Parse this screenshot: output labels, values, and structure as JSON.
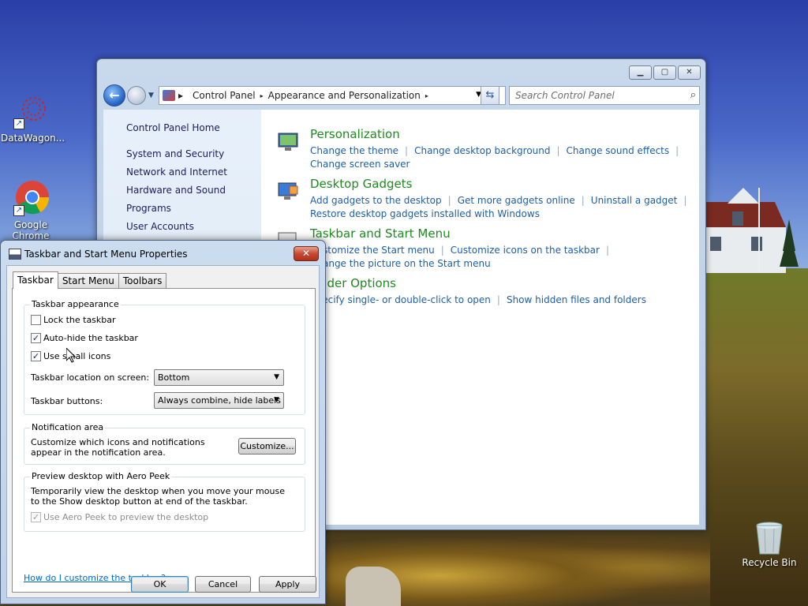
{
  "desktop": {
    "icons": [
      {
        "label": "DataWagon...",
        "icon": "datawagon-icon"
      },
      {
        "label": "Google Chrome",
        "icon": "chrome-icon"
      },
      {
        "label": "Recycle Bin",
        "icon": "recycle-bin-icon"
      }
    ]
  },
  "control_panel": {
    "caption": {
      "minimize": "minimize-icon",
      "maximize": "maximize-icon",
      "close": "close-icon"
    },
    "breadcrumb": [
      "Control Panel",
      "Appearance and Personalization"
    ],
    "search_placeholder": "Search Control Panel",
    "sidebar": {
      "home": "Control Panel Home",
      "items": [
        "System and Security",
        "Network and Internet",
        "Hardware and Sound",
        "Programs",
        "User Accounts"
      ]
    },
    "categories": [
      {
        "title": "Personalization",
        "icon": "personalization-icon",
        "links": [
          "Change the theme",
          "Change desktop background",
          "Change sound effects",
          "Change screen saver"
        ]
      },
      {
        "title": "Desktop Gadgets",
        "icon": "gadgets-icon",
        "links": [
          "Add gadgets to the desktop",
          "Get more gadgets online",
          "Uninstall a gadget",
          "Restore desktop gadgets installed with Windows"
        ]
      },
      {
        "title": "Taskbar and Start Menu",
        "icon": "taskbar-icon",
        "links": [
          "Customize the Start menu",
          "Customize icons on the taskbar",
          "Change the picture on the Start menu"
        ]
      },
      {
        "title": "Folder Options",
        "icon": "folder-options-icon",
        "links": [
          "Specify single- or double-click to open",
          "Show hidden files and folders"
        ]
      }
    ]
  },
  "dialog": {
    "title": "Taskbar and Start Menu Properties",
    "close_label": "✕",
    "tabs": [
      "Taskbar",
      "Start Menu",
      "Toolbars"
    ],
    "active_tab": "Taskbar",
    "appearance": {
      "group_label": "Taskbar appearance",
      "lock": {
        "label": "Lock the taskbar",
        "checked": false
      },
      "autohide": {
        "label": "Auto-hide the taskbar",
        "checked": true
      },
      "small_icons": {
        "label": "Use small icons",
        "checked": true
      },
      "location_label": "Taskbar location on screen:",
      "location_value": "Bottom",
      "buttons_label": "Taskbar buttons:",
      "buttons_value": "Always combine, hide labels"
    },
    "notification": {
      "group_label": "Notification area",
      "text": "Customize which icons and notifications appear in the notification area.",
      "button": "Customize..."
    },
    "aero_peek": {
      "group_label": "Preview desktop with Aero Peek",
      "text": "Temporarily view the desktop when you move your mouse to the Show desktop button at end of the taskbar.",
      "checkbox": {
        "label": "Use Aero Peek to preview the desktop",
        "checked": true,
        "disabled": true
      }
    },
    "help_link": "How do I customize the taskbar?",
    "buttons": {
      "ok": "OK",
      "cancel": "Cancel",
      "apply": "Apply"
    }
  }
}
